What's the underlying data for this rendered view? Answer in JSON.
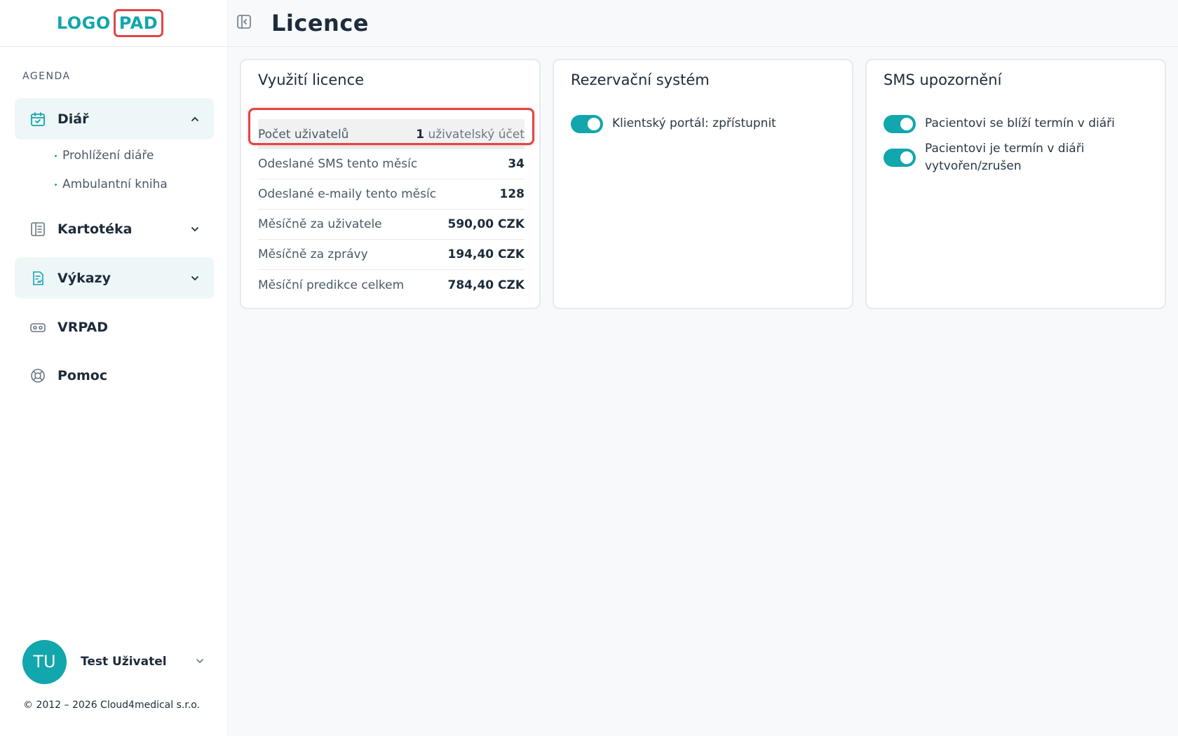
{
  "logo": {
    "left": "LOGO",
    "right": "PAD"
  },
  "sidebar": {
    "section_label": "AGENDA",
    "items": [
      {
        "label": "Diář",
        "icon": "calendar-check-icon",
        "expanded": true,
        "children": [
          {
            "label": "Prohlížení diáře"
          },
          {
            "label": "Ambulantní kniha"
          }
        ]
      },
      {
        "label": "Kartotéka",
        "icon": "book-icon"
      },
      {
        "label": "Výkazy",
        "icon": "report-icon"
      },
      {
        "label": "VRPAD",
        "icon": "vr-headset-icon"
      },
      {
        "label": "Pomoc",
        "icon": "lifebuoy-icon"
      }
    ],
    "user": {
      "initials": "TU",
      "name": "Test Uživatel"
    },
    "copyright": "© 2012 – 2026 Cloud4medical s.r.o."
  },
  "header": {
    "title": "Licence"
  },
  "license_card": {
    "title": "Využití licence",
    "rows": [
      {
        "label": "Počet uživatelů",
        "value_number": "1",
        "value_unit": "uživatelský účet"
      },
      {
        "label": "Odeslané SMS tento měsíc",
        "value": "34"
      },
      {
        "label": "Odeslané e-maily tento měsíc",
        "value": "128"
      },
      {
        "label": "Měsíčně za uživatele",
        "value": "590,00 CZK"
      },
      {
        "label": "Měsíčně za zprávy",
        "value": "194,40 CZK"
      },
      {
        "label": "Měsíční predikce celkem",
        "value": "784,40 CZK"
      }
    ]
  },
  "reservation_card": {
    "title": "Rezervační systém",
    "toggles": [
      {
        "label": "Klientský portál: zpřístupnit",
        "on": true
      }
    ]
  },
  "sms_card": {
    "title": "SMS upozornění",
    "toggles": [
      {
        "label": "Pacientovi se blíží termín v diáři",
        "on": true
      },
      {
        "label_line1": "Pacientovi je termín v diáři",
        "label_line2": "vytvořen/zrušen",
        "on": true
      }
    ]
  },
  "colors": {
    "accent": "#12a6ad",
    "highlight": "#e04646",
    "text": "#1d2b3a"
  }
}
